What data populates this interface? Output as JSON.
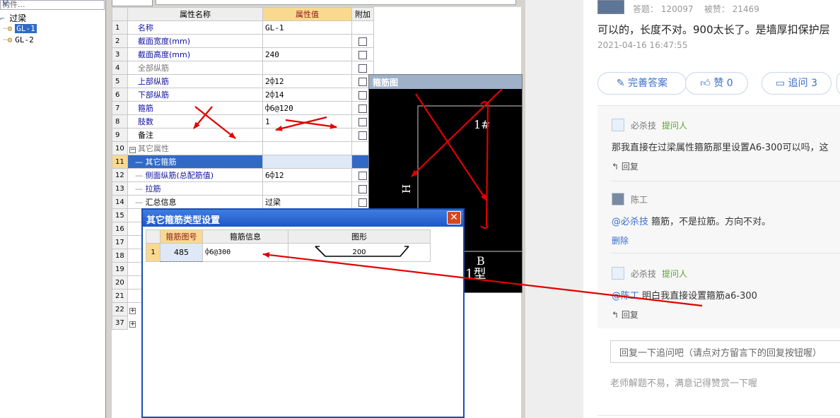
{
  "tree": {
    "search_placeholder": "构件...",
    "root": "过梁",
    "items": [
      "GL-1",
      "GL-2"
    ]
  },
  "grid": {
    "headers": {
      "name": "属性名称",
      "value": "属性值",
      "extra": "附加"
    },
    "rows": [
      {
        "num": "1",
        "name": "名称",
        "value": "GL-1",
        "cb": false
      },
      {
        "num": "2",
        "name": "截面宽度(mm)",
        "value": "",
        "cb": true
      },
      {
        "num": "3",
        "name": "截面高度(mm)",
        "value": "240",
        "cb": true
      },
      {
        "num": "4",
        "name": "全部纵筋",
        "value": "",
        "cb": true
      },
      {
        "num": "5",
        "name": "上部纵筋",
        "value": "2⌽12",
        "cb": true
      },
      {
        "num": "6",
        "name": "下部纵筋",
        "value": "2⌽14",
        "cb": true
      },
      {
        "num": "7",
        "name": "箍筋",
        "value": "⌽6@120",
        "cb": true
      },
      {
        "num": "8",
        "name": "肢数",
        "value": "1",
        "cb": true
      },
      {
        "num": "9",
        "name": "备注",
        "value": "",
        "cb": true
      },
      {
        "num": "10",
        "name": "其它属性",
        "value": "",
        "cb": false
      },
      {
        "num": "11",
        "name": "其它箍筋",
        "value": "",
        "cb": false
      },
      {
        "num": "12",
        "name": "侧面纵筋(总配筋值)",
        "value": "6⌽12",
        "cb": true
      },
      {
        "num": "13",
        "name": "拉筋",
        "value": "",
        "cb": true
      },
      {
        "num": "14",
        "name": "汇总信息",
        "value": "过梁",
        "cb": true
      },
      {
        "num": "15",
        "name": "",
        "value": "",
        "cb": false
      },
      {
        "num": "16",
        "name": "",
        "value": "",
        "cb": false
      },
      {
        "num": "17",
        "name": "",
        "value": "",
        "cb": false
      },
      {
        "num": "18",
        "name": "",
        "value": "",
        "cb": false
      },
      {
        "num": "19",
        "name": "",
        "value": "",
        "cb": false
      },
      {
        "num": "20",
        "name": "",
        "value": "",
        "cb": false
      },
      {
        "num": "21",
        "name": "",
        "value": "",
        "cb": false
      },
      {
        "num": "22",
        "name": "",
        "value": "",
        "cb": false
      },
      {
        "num": "37",
        "name": "",
        "value": "",
        "cb": false
      }
    ]
  },
  "stirrup_window": {
    "title": "箍筋图",
    "label_1": "1#",
    "label_h": "H",
    "label_b": "B",
    "label_type": "1型"
  },
  "dialog": {
    "title": "其它箍筋类型设置",
    "headers": [
      "箍筋图号",
      "箍筋信息",
      "图形"
    ],
    "row": {
      "num": "1",
      "code": "485",
      "info": "⌽6@300",
      "shape_dim": "200"
    }
  },
  "qa": {
    "stats": {
      "answers_label": "答题：",
      "answers": "120097",
      "likes_label": "被赞：",
      "likes": "21469"
    },
    "answer_text": "可以的，长度不对。900太长了。是墙厚扣保护层",
    "date": "2021-04-16 16:47:55",
    "buttons": {
      "improve": "完善答案",
      "like": "赞 0",
      "followup": "追问 3"
    },
    "thread": [
      {
        "user": "必杀技",
        "tag": "提问人",
        "text": "那我直接在过梁属性箍筋那里设置A6-300可以吗，这",
        "action": "回复"
      },
      {
        "user": "陈工",
        "tag": "",
        "mention": "@必杀技",
        "text": " 箍筋，不是拉筋。方向不对。",
        "action": "删除"
      },
      {
        "user": "必杀技",
        "tag": "提问人",
        "mention": "@陈工",
        "text": " 明白我直接设置箍筋a6-300",
        "action": "回复"
      }
    ],
    "reply_placeholder": "回复一下追问吧（请点对方留言下的回复按钮喔）",
    "footer": "老师解题不易，满意记得赞赏一下喔"
  },
  "colors": {
    "annotation_red": "#e00000",
    "link_blue": "#3b6fc9",
    "select_blue": "#316ac5",
    "header_orange": "#f9d98f"
  }
}
